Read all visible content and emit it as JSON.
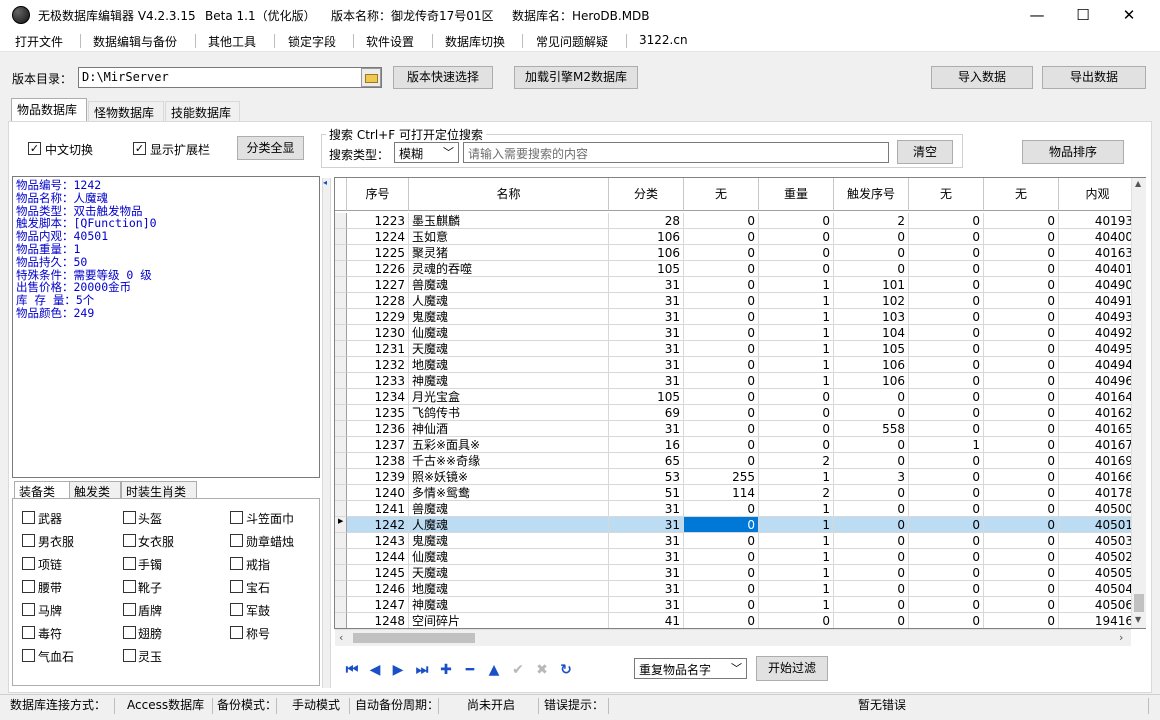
{
  "window": {
    "app_title": "无极数据库编辑器 V4.2.3.15",
    "edition": "Beta 1.1（优化版）",
    "version_name": "版本名称：御龙传奇17号01区",
    "database_name": "数据库名：HeroDB.MDB",
    "minimize": "—",
    "maximize": "☐",
    "close": "✕"
  },
  "menu": [
    "打开文件",
    "数据编辑与备份",
    "其他工具",
    "锁定字段",
    "软件设置",
    "数据库切换",
    "常见问题解疑",
    "3122.cn"
  ],
  "toolbar": {
    "dir_label": "版本目录：",
    "dir_value": "D:\\MirServer",
    "quick_select": "版本快速选择",
    "load_engine": "加载引擎M2数据库",
    "import": "导入数据",
    "export": "导出数据"
  },
  "tabs": [
    "物品数据库",
    "怪物数据库",
    "技能数据库"
  ],
  "options": {
    "chinese_switch": "中文切换",
    "show_extended": "显示扩展栏",
    "show_all_categories": "分类全显"
  },
  "search": {
    "group_title": "搜索  Ctrl+F 可打开定位搜索",
    "type_label": "搜索类型：",
    "type_value": "模糊",
    "placeholder": "请输入需要搜索的内容",
    "clear": "清空",
    "sort": "物品排序"
  },
  "info": [
    "物品编号：1242",
    "物品名称：人魔魂",
    "物品类型：双击触发物品",
    "触发脚本：[QFunction]0",
    "物品内观：40501",
    "物品重量：1",
    "物品持久：50",
    "特殊条件：需要等级 0 级",
    "出售价格：20000金币",
    "库 存 量：5个",
    "物品颜色：249"
  ],
  "category_tabs": [
    "装备类",
    "触发类",
    "时装生肖类"
  ],
  "categories": [
    [
      "武器",
      "头盔",
      "斗笠面巾"
    ],
    [
      "男衣服",
      "女衣服",
      "勋章蜡烛"
    ],
    [
      "项链",
      "手镯",
      "戒指"
    ],
    [
      "腰带",
      "靴子",
      "宝石"
    ],
    [
      "马牌",
      "盾牌",
      "军鼓"
    ],
    [
      "毒符",
      "翅膀",
      "称号"
    ],
    [
      "气血石",
      "灵玉",
      ""
    ]
  ],
  "grid": {
    "headers": [
      "序号",
      "名称",
      "分类",
      "无",
      "重量",
      "触发序号",
      "无",
      "无",
      "内观"
    ],
    "selected_index": 19,
    "rows": [
      [
        "1223",
        "墨玉麒麟",
        "28",
        "0",
        "0",
        "2",
        "0",
        "0",
        "40193"
      ],
      [
        "1224",
        "玉如意",
        "106",
        "0",
        "0",
        "0",
        "0",
        "0",
        "40400"
      ],
      [
        "1225",
        "聚灵猪",
        "106",
        "0",
        "0",
        "0",
        "0",
        "0",
        "40163"
      ],
      [
        "1226",
        "灵魂的吞噬",
        "105",
        "0",
        "0",
        "0",
        "0",
        "0",
        "40401"
      ],
      [
        "1227",
        "兽魔魂",
        "31",
        "0",
        "1",
        "101",
        "0",
        "0",
        "40490"
      ],
      [
        "1228",
        "人魔魂",
        "31",
        "0",
        "1",
        "102",
        "0",
        "0",
        "40491"
      ],
      [
        "1229",
        "鬼魔魂",
        "31",
        "0",
        "1",
        "103",
        "0",
        "0",
        "40493"
      ],
      [
        "1230",
        "仙魔魂",
        "31",
        "0",
        "1",
        "104",
        "0",
        "0",
        "40492"
      ],
      [
        "1231",
        "天魔魂",
        "31",
        "0",
        "1",
        "105",
        "0",
        "0",
        "40495"
      ],
      [
        "1232",
        "地魔魂",
        "31",
        "0",
        "1",
        "106",
        "0",
        "0",
        "40494"
      ],
      [
        "1233",
        "神魔魂",
        "31",
        "0",
        "1",
        "106",
        "0",
        "0",
        "40496"
      ],
      [
        "1234",
        "月光宝盒",
        "105",
        "0",
        "0",
        "0",
        "0",
        "0",
        "40164"
      ],
      [
        "1235",
        "飞鸽传书",
        "69",
        "0",
        "0",
        "0",
        "0",
        "0",
        "40162"
      ],
      [
        "1236",
        "神仙酒",
        "31",
        "0",
        "0",
        "558",
        "0",
        "0",
        "40165"
      ],
      [
        "1237",
        "五彩※面具※",
        "16",
        "0",
        "0",
        "0",
        "1",
        "0",
        "40167"
      ],
      [
        "1238",
        "千古※※奇缘",
        "65",
        "0",
        "2",
        "0",
        "0",
        "0",
        "40169"
      ],
      [
        "1239",
        "照※妖镜※",
        "53",
        "255",
        "1",
        "3",
        "0",
        "0",
        "40166"
      ],
      [
        "1240",
        "多情※鸳鸯",
        "51",
        "114",
        "2",
        "0",
        "0",
        "0",
        "40178"
      ],
      [
        "1241",
        "兽魔魂",
        "31",
        "0",
        "1",
        "0",
        "0",
        "0",
        "40500"
      ],
      [
        "1242",
        "人魔魂",
        "31",
        "0",
        "1",
        "0",
        "0",
        "0",
        "40501"
      ],
      [
        "1243",
        "鬼魔魂",
        "31",
        "0",
        "1",
        "0",
        "0",
        "0",
        "40503"
      ],
      [
        "1244",
        "仙魔魂",
        "31",
        "0",
        "1",
        "0",
        "0",
        "0",
        "40502"
      ],
      [
        "1245",
        "天魔魂",
        "31",
        "0",
        "1",
        "0",
        "0",
        "0",
        "40505"
      ],
      [
        "1246",
        "地魔魂",
        "31",
        "0",
        "1",
        "0",
        "0",
        "0",
        "40504"
      ],
      [
        "1247",
        "神魔魂",
        "31",
        "0",
        "1",
        "0",
        "0",
        "0",
        "40506"
      ],
      [
        "1248",
        "空间碎片",
        "41",
        "0",
        "0",
        "0",
        "0",
        "0",
        "19416"
      ]
    ]
  },
  "navigator": {
    "icons": [
      "first-record-icon",
      "prior-record-icon",
      "next-record-icon",
      "last-record-icon",
      "insert-record-icon",
      "delete-record-icon",
      "edit-record-icon",
      "post-record-icon",
      "cancel-record-icon",
      "refresh-record-icon"
    ],
    "filter_value": "重复物品名字",
    "filter_button": "开始过滤"
  },
  "status": {
    "conn_label": "数据库连接方式：",
    "conn_value": "Access数据库",
    "backup_label": "备份模式：",
    "backup_value": "手动模式",
    "auto_label": "自动备份周期：",
    "auto_value": "尚未开启",
    "error_label": "错误提示：",
    "error_value": "暂无错误"
  }
}
